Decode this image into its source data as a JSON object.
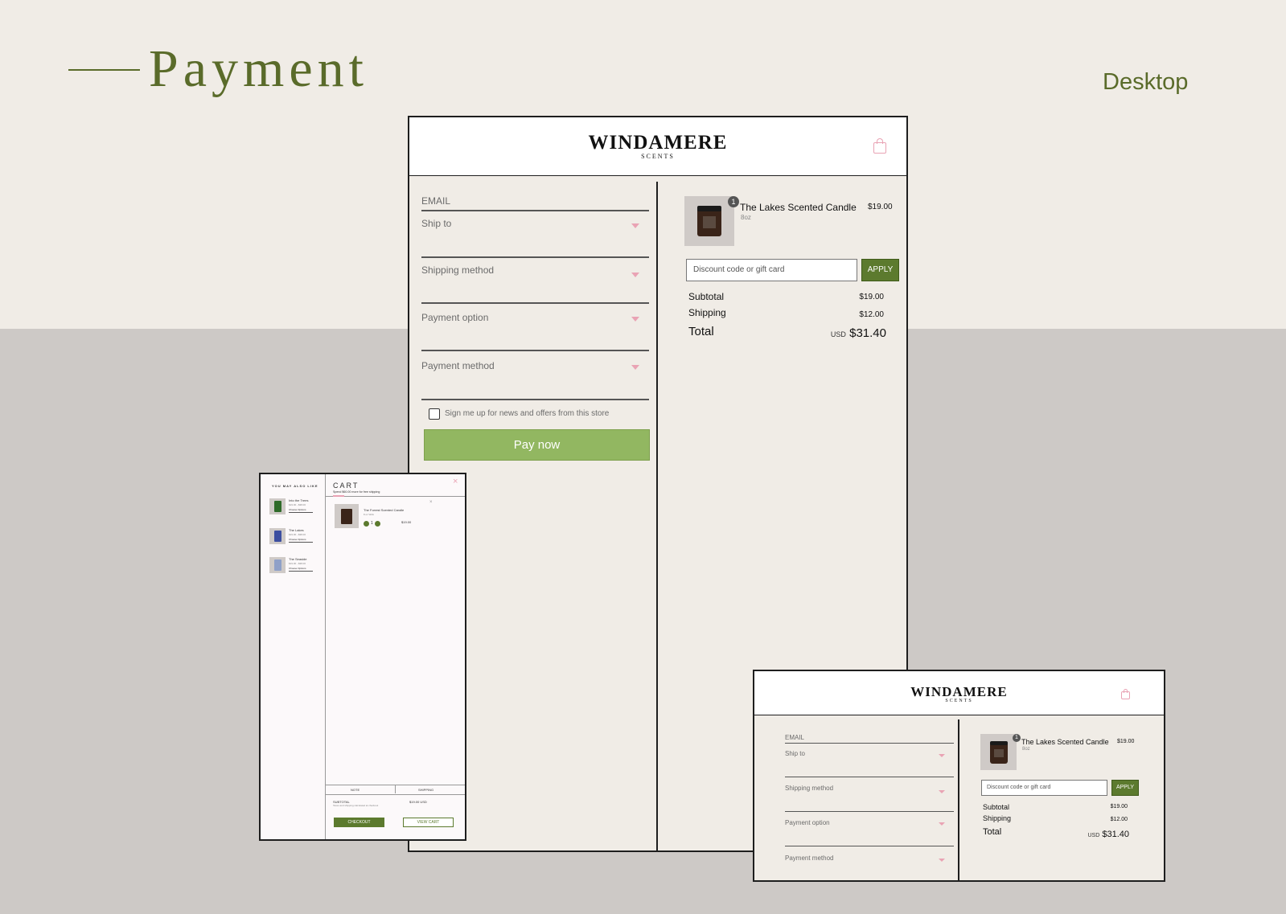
{
  "page": {
    "title": "Payment",
    "device_label": "Desktop"
  },
  "brand": {
    "name": "WINDAMERE",
    "subtitle": "SCENTS"
  },
  "checkout": {
    "email_label": "EMAIL",
    "fields": [
      {
        "label": "Ship to"
      },
      {
        "label": "Shipping method"
      },
      {
        "label": "Payment option"
      },
      {
        "label": "Payment method"
      }
    ],
    "newsletter_label": "Sign me up for news and offers from this store",
    "pay_button": "Pay now"
  },
  "order": {
    "item": {
      "name": "The Lakes Scented Candle",
      "variant": "8oz",
      "price": "$19.00",
      "quantity": "1"
    },
    "discount_placeholder": "Discount code or gift card",
    "apply_label": "APPLY",
    "subtotal_label": "Subtotal",
    "subtotal_value": "$19.00",
    "shipping_label": "Shipping",
    "shipping_value": "$12.00",
    "total_label": "Total",
    "currency": "USD",
    "total_value": "$31.40"
  },
  "cart_drawer": {
    "recommend_heading": "YOU MAY ALSO LIKE",
    "recommendations": [
      {
        "name": "Into the Trees",
        "price": "$19.00 - $38.00",
        "link": "Choose Options",
        "color": "#2f6b2a"
      },
      {
        "name": "The Lakes",
        "price": "$19.00 - $38.00",
        "link": "Choose Options",
        "color": "#3d4fa0"
      },
      {
        "name": "The Seaside",
        "price": "$19.00 - $38.00",
        "link": "Choose Options",
        "color": "#8fa0c8"
      }
    ],
    "title": "CART",
    "close": "×",
    "shipping_note": "Spend $60.00 more for free shipping",
    "item": {
      "name": "The Forrest Scented Candle",
      "variant": "8 oz Wick",
      "price": "$19.00",
      "quantity": "1",
      "remove": "×"
    },
    "tabs": [
      "NOTE",
      "SHIPPING"
    ],
    "subtotal_label": "SUBTOTAL",
    "subtotal_value": "$19.00 USD",
    "subtotal_note": "Taxes and shipping calculated at checkout",
    "checkout_button": "CHECKOUT",
    "view_cart_button": "VIEW CART"
  },
  "colors": {
    "brand_green": "#5a6b2a",
    "pay_green": "#92b761",
    "apply_green": "#5c7a2e",
    "accent_pink": "#e9a3b4",
    "page_bg": "#f0ece6",
    "lower_bg": "#cdc9c6"
  },
  "icons": {
    "cart": "shopping-bag-icon",
    "dropdown": "chevron-down-icon",
    "close": "close-icon"
  }
}
